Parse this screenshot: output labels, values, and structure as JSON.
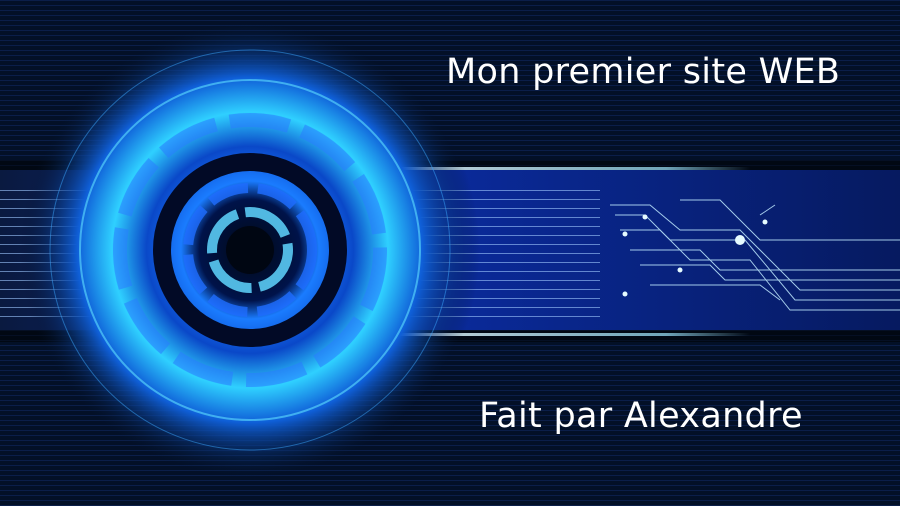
{
  "slide": {
    "title": "Mon premier site WEB",
    "subtitle": "Fait par Alexandre"
  },
  "colors": {
    "background": "#031027",
    "glow": "#22c8ff",
    "band": "#0a2f9a",
    "text": "#ffffff"
  }
}
